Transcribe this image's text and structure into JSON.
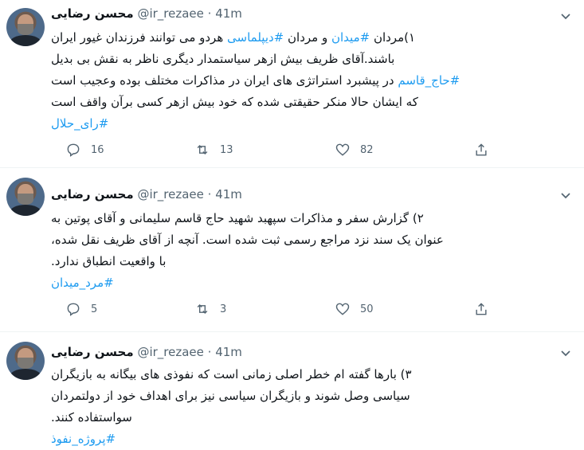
{
  "tweets": [
    {
      "name": "محسن رضایی",
      "handle": "@ir_rezaee",
      "sep": "·",
      "time": "41m",
      "lines": [
        [
          {
            "t": "۱)مردان "
          },
          {
            "h": "#میدان"
          },
          {
            "t": " و مردان "
          },
          {
            "h": "#دیپلماسی"
          },
          {
            "t": " هردو می توانند فرزندان غیور ایران"
          }
        ],
        [
          {
            "t": "باشند.آقای ظریف بیش ازهر سیاستمدار دیگری ناظر به نقش بی بدیل"
          }
        ],
        [
          {
            "h": "#حاج_قاسم"
          },
          {
            "t": " در پیشبرد استراتژی های ایران در مذاکرات مختلف بوده وعجیب است"
          }
        ],
        [
          {
            "t": "که ایشان حالا منکر حقیقتی شده که خود بیش ازهر کسی برآن واقف است"
          }
        ],
        [
          {
            "h": "#رای_حلال"
          }
        ]
      ],
      "replies": "16",
      "retweets": "13",
      "likes": "82"
    },
    {
      "name": "محسن رضایی",
      "handle": "@ir_rezaee",
      "sep": "·",
      "time": "41m",
      "lines": [
        [
          {
            "t": "۲) گزارش سفر و مذاکرات سپهبد شهید حاج قاسم سلیمانی و آقای پوتین به"
          }
        ],
        [
          {
            "t": "عنوان یک سند نزد مراجع رسمی ثبت شده است. آنچه از  آقای ظریف نقل شده،"
          }
        ],
        [
          {
            "t": "با واقعیت انطباق ندارد."
          }
        ],
        [
          {
            "h": "#مرد_میدان"
          }
        ]
      ],
      "replies": "5",
      "retweets": "3",
      "likes": "50"
    },
    {
      "name": "محسن رضایی",
      "handle": "@ir_rezaee",
      "sep": "·",
      "time": "41m",
      "lines": [
        [
          {
            "t": "۳) بارها گفته ام خطر اصلی زمانی است که نفوذی های بیگانه به بازیگران"
          }
        ],
        [
          {
            "t": "سیاسی وصل شوند و بازیگران سیاسی نیز برای اهداف خود از دولتمردان"
          }
        ],
        [
          {
            "t": "سواستفاده کنند."
          }
        ],
        [
          {
            "h": "#پروژه_نفوذ"
          }
        ]
      ]
    }
  ],
  "colors": {
    "hashtag": "#1d9bf0",
    "muted": "#536471",
    "text": "#0f1419"
  },
  "icons": [
    "reply-icon",
    "retweet-icon",
    "like-icon",
    "share-icon",
    "chevron-down-icon"
  ]
}
